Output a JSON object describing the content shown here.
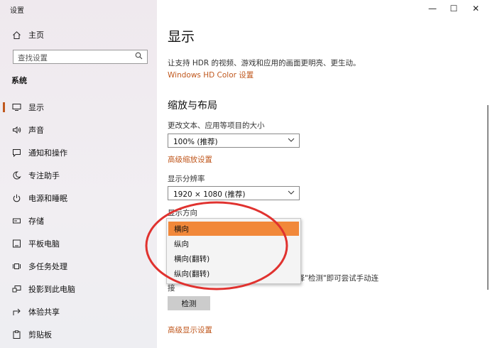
{
  "window": {
    "title": "设置",
    "minimize_glyph": "—",
    "maximize_glyph": "☐",
    "close_glyph": "✕"
  },
  "sidebar": {
    "home_label": "主页",
    "search_placeholder": "查找设置",
    "section_title": "系统",
    "items": [
      {
        "label": "显示",
        "icon": "monitor-icon",
        "active": true
      },
      {
        "label": "声音",
        "icon": "speaker-icon"
      },
      {
        "label": "通知和操作",
        "icon": "notification-icon"
      },
      {
        "label": "专注助手",
        "icon": "moon-icon"
      },
      {
        "label": "电源和睡眠",
        "icon": "power-icon"
      },
      {
        "label": "存储",
        "icon": "storage-icon"
      },
      {
        "label": "平板电脑",
        "icon": "tablet-icon"
      },
      {
        "label": "多任务处理",
        "icon": "multitask-icon"
      },
      {
        "label": "投影到此电脑",
        "icon": "project-icon"
      },
      {
        "label": "体验共享",
        "icon": "share-icon"
      },
      {
        "label": "剪贴板",
        "icon": "clipboard-icon"
      }
    ]
  },
  "main": {
    "page_title": "显示",
    "hdr_description": "让支持 HDR 的视频、游戏和应用的画面更明亮、更生动。",
    "hdr_link": "Windows HD Color 设置",
    "scale_section_title": "缩放与布局",
    "text_size_label": "更改文本、应用等项目的大小",
    "text_size_value": "100% (推荐)",
    "advanced_scaling_link": "高级缩放设置",
    "resolution_label": "显示分辨率",
    "resolution_value": "1920 × 1080 (推荐)",
    "orientation_label": "显示方向",
    "orientation_options": [
      "横向",
      "纵向",
      "横向(翻转)",
      "纵向(翻转)"
    ],
    "orientation_selected": "横向",
    "detect_text_partial": "选择\"检测\"即可尝试手动连",
    "detect_text_line2_partial": "接",
    "detect_button": "检测",
    "advanced_display_link": "高级显示设置"
  },
  "colors": {
    "accent": "#c0581e",
    "dropdown_highlight": "#f1883a",
    "annotation_red": "#e0322f"
  }
}
